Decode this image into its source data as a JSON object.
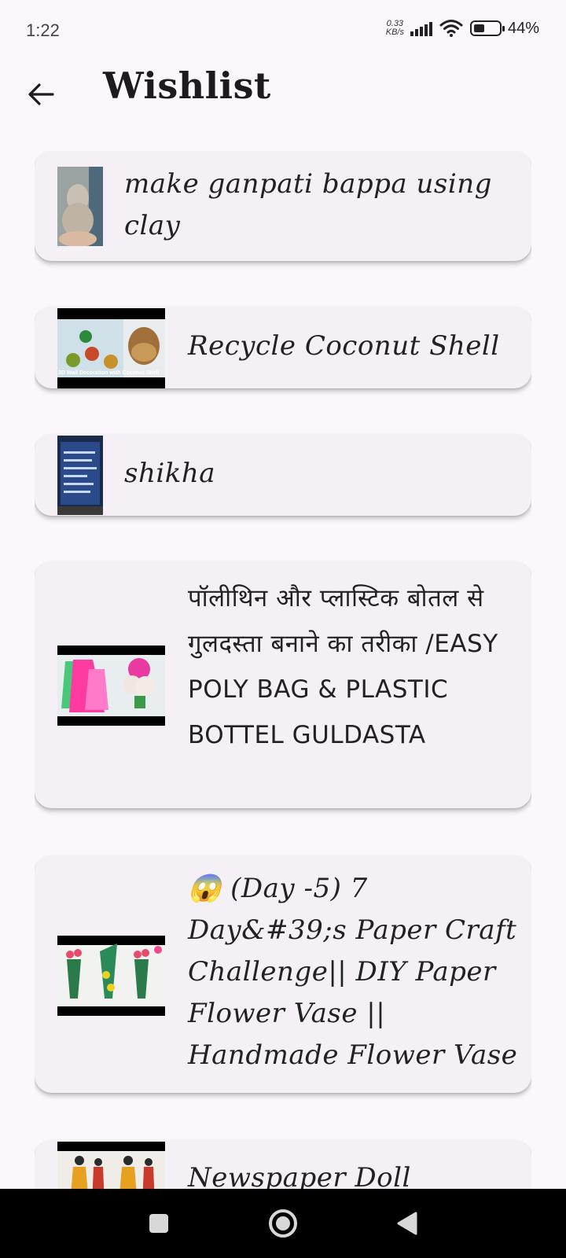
{
  "status": {
    "time": "1:22",
    "net_speed_value": "0.33",
    "net_speed_unit": "KB/s",
    "battery": "44%",
    "battery_level": 0.44
  },
  "header": {
    "title": "Wishlist",
    "back_icon": "arrow-left-icon"
  },
  "wishlist": [
    {
      "title": "make ganpati bappa using clay",
      "thumbnail": "clay-ganesha-photo"
    },
    {
      "title": "Recycle Coconut Shell",
      "thumbnail": "coconut-shell-craft-video",
      "thumb_caption": "3D Wall Decoration with Coconut Shell"
    },
    {
      "title": "shikha",
      "thumbnail": "computer-screen-photo"
    },
    {
      "title": "पॉलीथिन और प्लास्टिक बोतल से गुलदस्ता बनाने का तरीका /EASY POLY BAG & PLASTIC BOTTEL GULDASTA",
      "thumbnail": "poly-bag-bouquet-video"
    },
    {
      "title": "😱 (Day -5) 7 Day&#39;s Paper Craft Challenge|| DIY Paper Flower Vase || Handmade Flower Vase",
      "thumbnail": "paper-flower-vase-video"
    },
    {
      "title": "Newspaper Doll",
      "thumbnail": "newspaper-doll-video"
    }
  ],
  "nav": {
    "recents_icon": "square-icon",
    "home_icon": "circle-icon",
    "back_icon": "triangle-back-icon"
  },
  "colors": {
    "background": "#fcf7fc",
    "card": "#f4f0f5",
    "text": "#1d1b1f",
    "nav_bar": "#000000"
  }
}
